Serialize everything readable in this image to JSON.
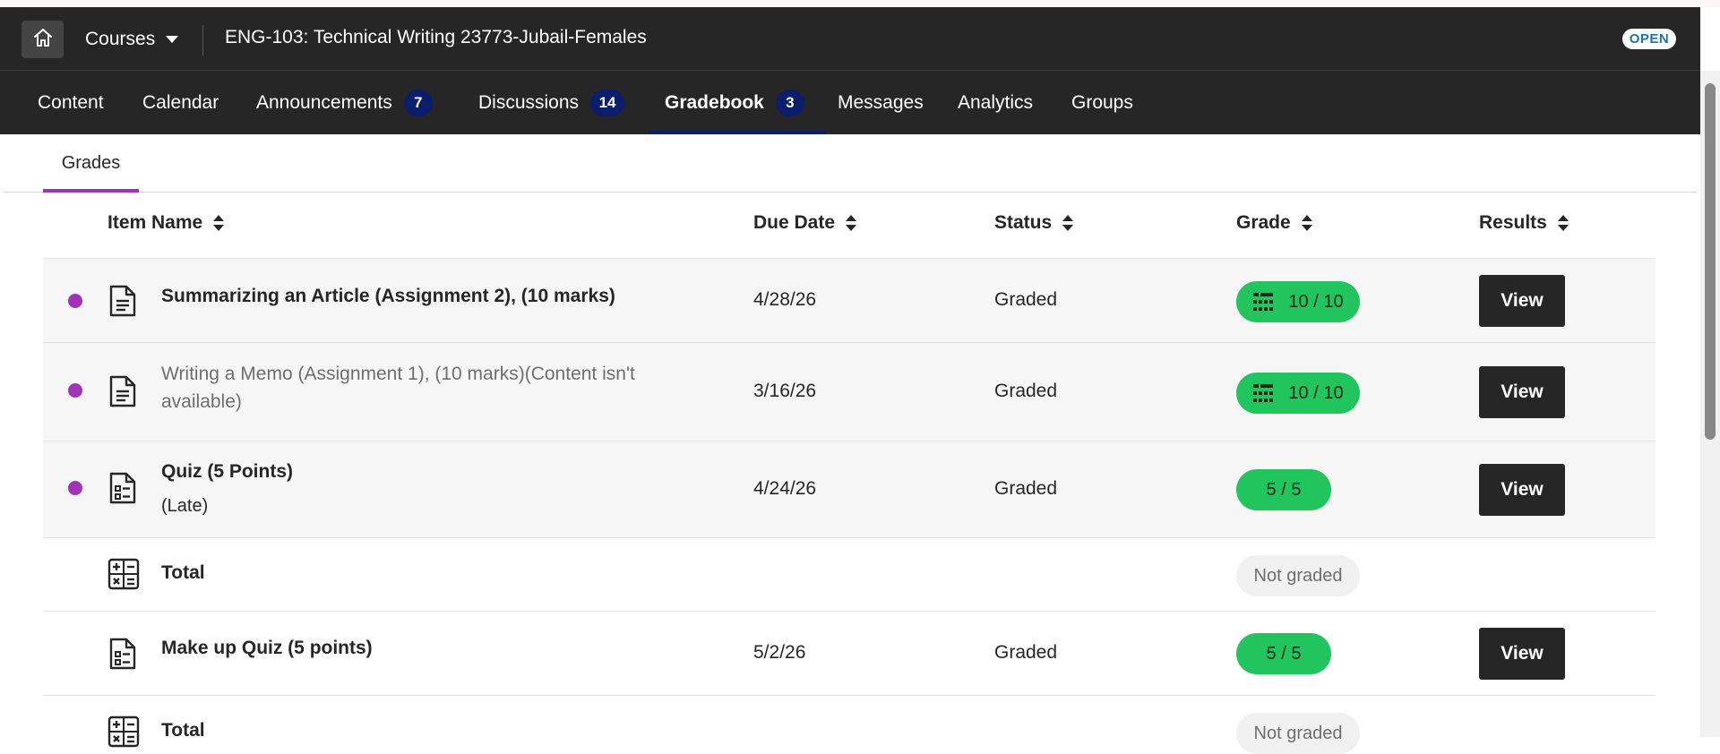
{
  "header": {
    "courses_label": "Courses",
    "course_title": "ENG-103: Technical Writing 23773-Jubail-Females",
    "status_badge": "OPEN"
  },
  "nav": {
    "tabs": [
      {
        "label": "Content",
        "count": ""
      },
      {
        "label": "Calendar",
        "count": ""
      },
      {
        "label": "Announcements",
        "count": "7"
      },
      {
        "label": "Discussions",
        "count": "14"
      },
      {
        "label": "Gradebook",
        "count": "3",
        "active": true
      },
      {
        "label": "Messages",
        "count": ""
      },
      {
        "label": "Analytics",
        "count": ""
      },
      {
        "label": "Groups",
        "count": ""
      }
    ]
  },
  "subtabs": {
    "grades": "Grades"
  },
  "table": {
    "columns": [
      "Item Name",
      "Due Date",
      "Status",
      "Grade",
      "Results"
    ],
    "rows": [
      {
        "name": "Summarizing an Article (Assignment 2), (10 marks)",
        "sub": "",
        "due": "4/28/26",
        "status": "Graded",
        "grade": "10 / 10",
        "results": "View",
        "unread": true
      },
      {
        "name": "Writing a Memo (Assignment 1), (10 marks)(Content isn't available)",
        "sub": "",
        "due": "3/16/26",
        "status": "Graded",
        "grade": "10 / 10",
        "results": "View",
        "unread": true
      },
      {
        "name": "Quiz (5 Points)",
        "sub": "(Late)",
        "due": "4/24/26",
        "status": "Graded",
        "grade": "5 / 5",
        "results": "View",
        "unread": true
      },
      {
        "name": "Total",
        "sub": "",
        "due": "",
        "status": "",
        "grade": "Not graded",
        "results": "",
        "unread": false
      },
      {
        "name": "Make up Quiz (5 points)",
        "sub": "",
        "due": "5/2/26",
        "status": "Graded",
        "grade": "5 / 5",
        "results": "View",
        "unread": false
      },
      {
        "name": "Total",
        "sub": "",
        "due": "",
        "status": "",
        "grade": "Not graded",
        "results": "",
        "unread": false
      }
    ]
  },
  "colors": {
    "topbar": "#262626",
    "count_badge": "#0b1e6b",
    "unread_dot": "#a133b7",
    "grade_pill": "#21c45d",
    "subtab_underline": "#a133b7"
  }
}
